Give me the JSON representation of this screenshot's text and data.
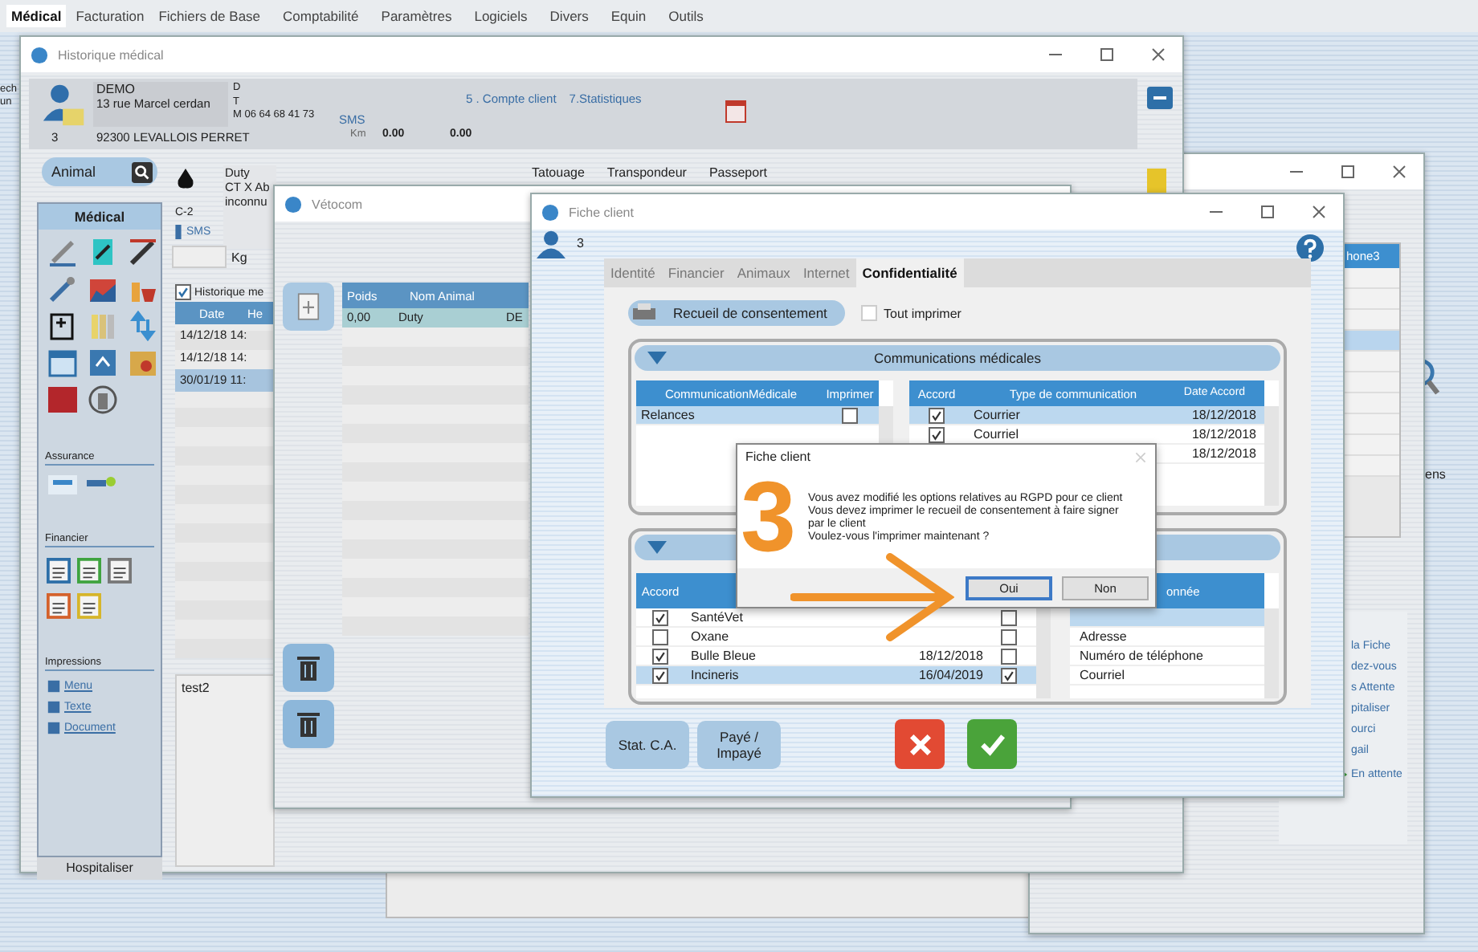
{
  "menu": [
    {
      "label": "Médical",
      "selected": true
    },
    {
      "label": "Facturation",
      "selected": false
    },
    {
      "label": "Fichiers de Base",
      "selected": false
    },
    {
      "label": "Comptabilité",
      "selected": false
    },
    {
      "label": "Paramètres",
      "selected": false
    },
    {
      "label": "Logiciels",
      "selected": false
    },
    {
      "label": "Divers",
      "selected": false
    },
    {
      "label": "Equin",
      "selected": false
    },
    {
      "label": "Outils",
      "selected": false
    }
  ],
  "background": {
    "left_texts": [
      "ech",
      "un"
    ],
    "right_text": "ens"
  },
  "historique": {
    "title": "Historique médical",
    "client": {
      "name": "DEMO",
      "street": "13 rue Marcel cerdan",
      "number": "3",
      "city": "92300 LEVALLOIS PERRET",
      "phones": [
        "D",
        "T",
        "M 06 64 68 41 73"
      ],
      "sms": "SMS",
      "km_label": "Km",
      "km_values": [
        "0.00",
        "0.00"
      ]
    },
    "links": [
      "5 . Compte client",
      "7.Statistiques"
    ],
    "animal_search": "Animal",
    "animal": {
      "lines": [
        "Duty",
        "CT X Ab",
        "inconnu"
      ],
      "code": "C-2",
      "sms": "SMS",
      "weight_unit": "Kg"
    },
    "id_labels": [
      "Tatouage",
      "Transpondeur",
      "Passeport"
    ],
    "sidebar": {
      "title": "Médical",
      "sections": [
        "Assurance",
        "Financier",
        "Impressions"
      ],
      "print_links": [
        "Menu",
        "Texte",
        "Document"
      ],
      "footer": "Hospitaliser"
    },
    "history": {
      "label": "Historique me",
      "checked": true,
      "columns": [
        "Date",
        "He"
      ],
      "rows": [
        {
          "date": "14/12/18",
          "time": "14:",
          "selected": false
        },
        {
          "date": "14/12/18",
          "time": "14:",
          "selected": false
        },
        {
          "date": "30/01/19",
          "time": "11:",
          "selected": true
        }
      ]
    },
    "note": "test2"
  },
  "back_window": {
    "list_header": "hone3",
    "list_rows": [
      {
        "selected": false
      },
      {
        "selected": false
      },
      {
        "selected": false
      },
      {
        "selected": true
      },
      {
        "selected": false
      },
      {
        "selected": false
      },
      {
        "selected": false
      },
      {
        "selected": false
      },
      {
        "selected": false
      },
      {
        "selected": false
      }
    ],
    "links": [
      {
        "label": "la Fiche",
        "kind": "text"
      },
      {
        "label": "dez-vous",
        "kind": "text"
      },
      {
        "label": "s Attente",
        "kind": "text"
      },
      {
        "label": "pitaliser",
        "kind": "text"
      },
      {
        "label": "ourci",
        "kind": "text"
      },
      {
        "label": "gail",
        "kind": "text"
      },
      {
        "label": "En attente",
        "kind": "arrow"
      }
    ]
  },
  "vetocom": {
    "title": "Vétocom",
    "columns": [
      "Poids",
      "Nom Animal"
    ],
    "rows": [
      {
        "weight": "0,00",
        "name": "Duty",
        "column_3": "DE",
        "selected": true
      }
    ]
  },
  "fiche": {
    "title": "Fiche client",
    "client_number": "3",
    "tabs": [
      {
        "label": "Identité",
        "selected": false
      },
      {
        "label": "Financier",
        "selected": false
      },
      {
        "label": "Animaux",
        "selected": false
      },
      {
        "label": "Internet",
        "selected": false
      },
      {
        "label": "Confidentialité",
        "selected": true
      }
    ],
    "consent_button": "Recueil de consentement",
    "print_all": {
      "label": "Tout imprimer",
      "checked": false
    },
    "medical": {
      "title": "Communications médicales",
      "left_columns": [
        "CommunicationMédicale",
        "Imprimer"
      ],
      "left_rows": [
        {
          "name": "Relances",
          "print": false,
          "selected": true
        }
      ],
      "right_columns": [
        "Accord",
        "Type de communication",
        "Date Accord"
      ],
      "right_rows": [
        {
          "accord": true,
          "type": "Courrier",
          "date": "18/12/2018",
          "selected": true
        },
        {
          "accord": true,
          "type": "Courriel",
          "date": "18/12/2018",
          "selected": false
        },
        {
          "date": "18/12/2018",
          "selected": false
        }
      ]
    },
    "partners": {
      "left_columns": [
        "Accord"
      ],
      "left_rows": [
        {
          "accord": true,
          "name": "SantéVet",
          "print": false,
          "selected": false
        },
        {
          "accord": false,
          "name": "Oxane",
          "print": false,
          "selected": false
        },
        {
          "accord": true,
          "name": "Bulle Bleue",
          "date": "18/12/2018",
          "print": false,
          "selected": false
        },
        {
          "accord": true,
          "name": "Incineris",
          "date": "16/04/2019",
          "print": true,
          "selected": true
        }
      ],
      "right_column": "onnée",
      "right_rows": [
        {
          "selected": true
        },
        {
          "label": "Adresse",
          "selected": false
        },
        {
          "label": "Numéro de téléphone",
          "selected": false
        },
        {
          "label": "Courriel",
          "selected": false
        }
      ]
    },
    "buttons": [
      "Stat. C.A.",
      "Payé / Impayé"
    ]
  },
  "dialog": {
    "title": "Fiche client",
    "message": "Vous avez modifié les options relatives au RGPD pour ce client\nVous devez imprimer le recueil de consentement à faire signer\npar le client\nVoulez-vous l'imprimer maintenant ?",
    "buttons": [
      {
        "label": "Oui",
        "selected": true
      },
      {
        "label": "Non",
        "selected": false
      }
    ]
  },
  "annotation": {
    "number": "3"
  }
}
